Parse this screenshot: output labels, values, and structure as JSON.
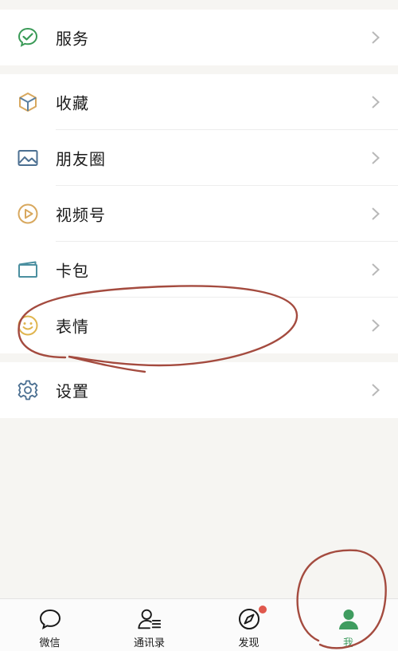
{
  "menu": {
    "service": {
      "label": "服务",
      "icon": "service-check-icon"
    },
    "items": [
      {
        "label": "收藏",
        "icon": "favorites-cube-icon"
      },
      {
        "label": "朋友圈",
        "icon": "moments-image-icon"
      },
      {
        "label": "视频号",
        "icon": "channels-play-icon"
      },
      {
        "label": "卡包",
        "icon": "card-wallet-icon"
      },
      {
        "label": "表情",
        "icon": "sticker-smile-icon"
      }
    ],
    "settings": {
      "label": "设置",
      "icon": "gear-icon"
    }
  },
  "tabbar": {
    "tabs": [
      {
        "label": "微信",
        "icon": "chat-bubble-icon"
      },
      {
        "label": "通讯录",
        "icon": "contacts-icon"
      },
      {
        "label": "发现",
        "icon": "compass-icon"
      },
      {
        "label": "我",
        "icon": "person-icon"
      }
    ],
    "active_index": 3
  },
  "colors": {
    "accent_green": "#3f9c5f",
    "badge_red": "#e0584d",
    "annotation_stroke": "#a44b3f",
    "icon_gold": "#d8a85e",
    "icon_blue": "#4b6f91"
  }
}
